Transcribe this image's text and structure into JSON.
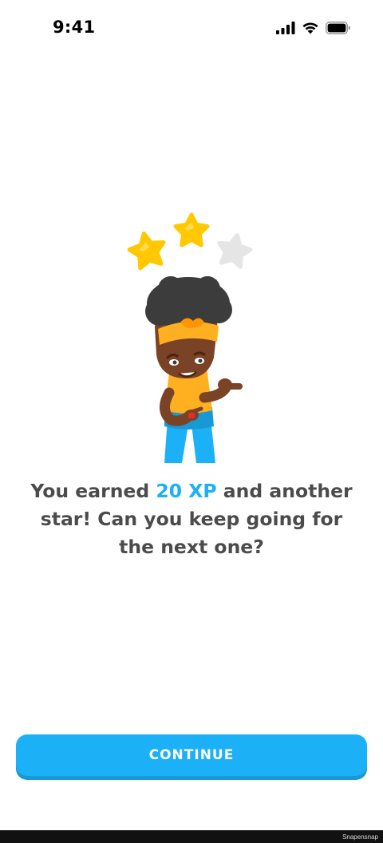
{
  "status_bar": {
    "time": "9:41",
    "icons": [
      "cellular-signal-icon",
      "wifi-icon",
      "battery-icon"
    ]
  },
  "stars": {
    "earned": 2,
    "total": 3
  },
  "message": {
    "part1": "You earned ",
    "xp": "20 XP",
    "part2": " and another star! Can you keep going for the next one?"
  },
  "continue_button": {
    "label": "CONTINUE"
  },
  "colors": {
    "accent": "#1cb0f6",
    "accent_shadow": "#1899d6",
    "text": "#4b4b4b",
    "star_gold": "#ffc800",
    "star_empty": "#e5e5e5"
  },
  "watermark": "Snapensnap"
}
